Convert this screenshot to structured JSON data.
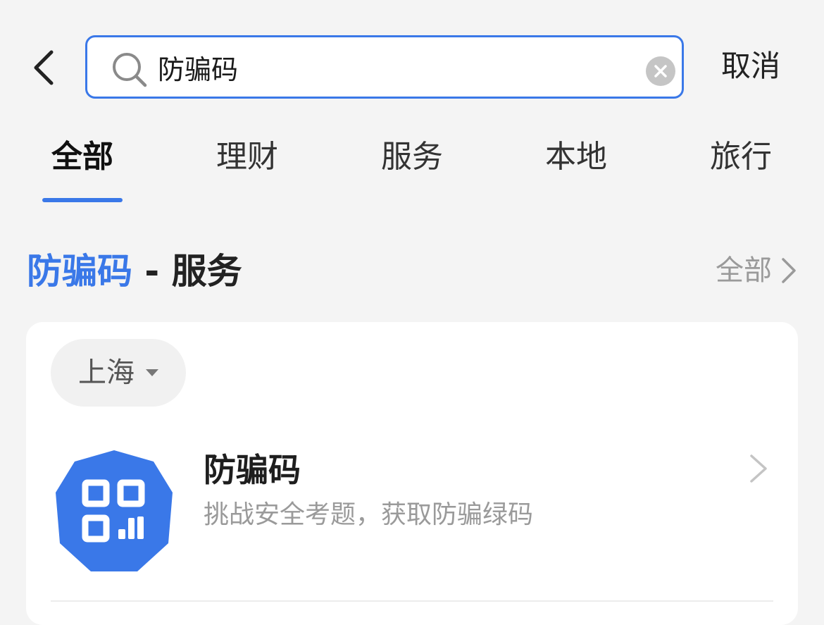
{
  "header": {
    "search_value": "防骗码",
    "search_placeholder": "",
    "cancel_label": "取消"
  },
  "tabs": [
    {
      "label": "全部",
      "active": true
    },
    {
      "label": "理财",
      "active": false
    },
    {
      "label": "服务",
      "active": false
    },
    {
      "label": "本地",
      "active": false
    },
    {
      "label": "旅行",
      "active": false
    }
  ],
  "section": {
    "keyword": "防骗码",
    "separator": " - ",
    "category": "服务",
    "all_label": "全部"
  },
  "card": {
    "city": "上海",
    "result": {
      "name": "防骗码",
      "description": "挑战安全考题，获取防骗绿码",
      "icon": "qr-code-icon"
    }
  },
  "colors": {
    "accent": "#3a78e8",
    "background": "#f4f4f4",
    "card": "#ffffff",
    "muted_text": "#9a9a9a"
  }
}
